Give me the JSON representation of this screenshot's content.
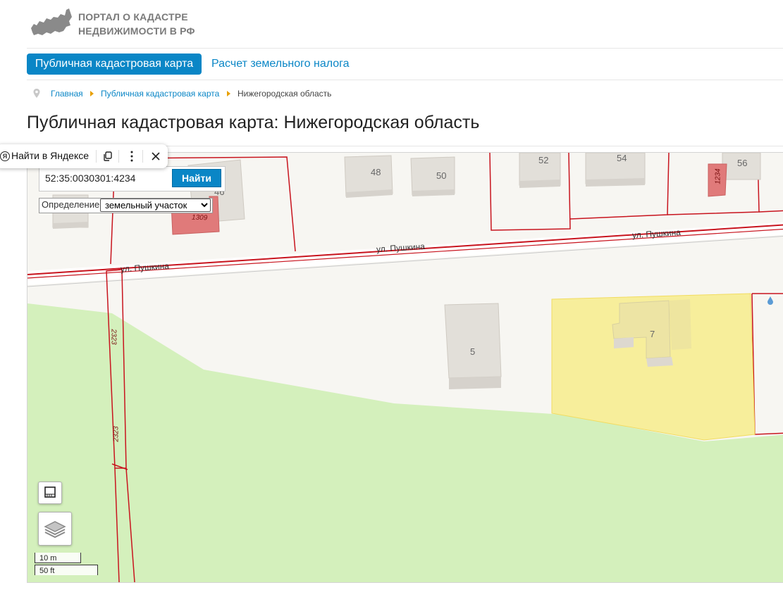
{
  "header": {
    "logo_line1": "ПОРТАЛ О КАДАСТРЕ",
    "logo_line2": "НЕДВИЖИМОСТИ В РФ"
  },
  "nav": {
    "tab_map": "Публичная кадастровая карта",
    "tab_tax": "Расчет земельного налога"
  },
  "breadcrumb": {
    "home": "Главная",
    "map": "Публичная кадастровая карта",
    "current": "Нижегородская область"
  },
  "page_title": "Публичная кадастровая карта: Нижегородская область",
  "yandex_toolbar": {
    "logo": "Я",
    "label": "Найти в Яндексе"
  },
  "search": {
    "value": "52:35:0030301:4234",
    "button": "Найти"
  },
  "definition": {
    "label": "Определение:",
    "selected": "земельный участок"
  },
  "map": {
    "street_labels": [
      "ул. Пушкина",
      "ул. Пушкина",
      "ул. Пушкина"
    ],
    "house_numbers": [
      "46",
      "48",
      "50",
      "52",
      "54",
      "56",
      "5",
      "7"
    ],
    "parcel_labels": [
      "1309",
      "1234",
      "2323",
      "2323"
    ],
    "colors": {
      "parcel_border": "#c8141e",
      "vegetation": "#d4f0bc",
      "selected_parcel": "#f7ec8c",
      "building": "#e2dfd9",
      "highlight_building": "#e07a7a",
      "accent": "#0a86c6"
    }
  },
  "scale": {
    "metric": "10 m",
    "imperial": "50 ft"
  }
}
